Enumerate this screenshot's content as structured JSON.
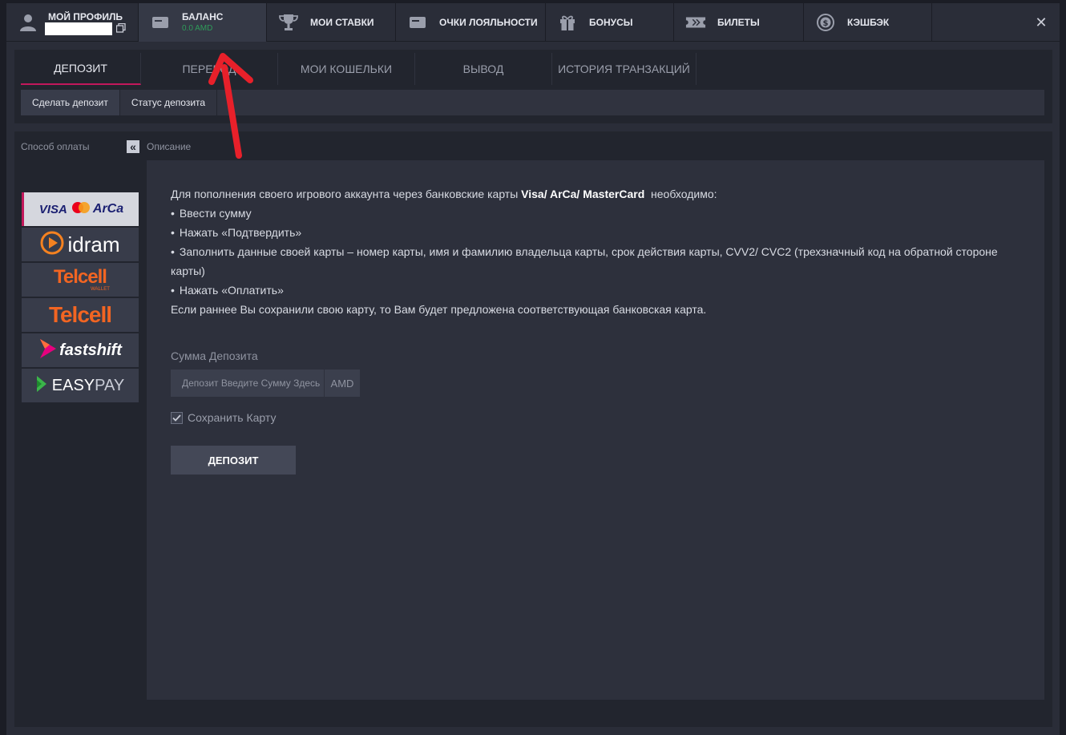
{
  "nav": {
    "profile_label": "Мой профиль",
    "balance_label": "Баланс",
    "balance_amount": "0.0 AMD",
    "bets_label": "Мои ставки",
    "loyalty_label": "Очки лояльности",
    "bonuses_label": "Бонусы",
    "tickets_label": "Билеты",
    "cashback_label": "Кэшбэк",
    "close_label": "✕"
  },
  "tabs": [
    "Депозит",
    "Перевод",
    "Мои кошельки",
    "Вывод",
    "История транзакций"
  ],
  "subtabs": [
    "Сделать депозит",
    "Статус депозита"
  ],
  "sidebar": {
    "title": "Способ оплаты",
    "collapse_label": "«",
    "methods": [
      {
        "name": "visa-arca",
        "logo_left": "VISA",
        "logo_right": "ArCa"
      },
      {
        "name": "idram",
        "logo": "idram"
      },
      {
        "name": "telcell-wallet",
        "logo": "Telcell",
        "sub": "WALLET"
      },
      {
        "name": "telcell",
        "logo": "Telcell"
      },
      {
        "name": "fastshift",
        "logo": "fastshift"
      },
      {
        "name": "easypay",
        "logo_left": "EASY",
        "logo_right": "PAY"
      }
    ]
  },
  "description": {
    "title": "Описание",
    "intro_pre": "Для пополнения своего игрового аккаунта через банковские карты ",
    "intro_bold": "Visa/ ArCa/ MasterCard",
    "intro_post": "  необходимо:",
    "steps": [
      "Ввести сумму",
      "Нажать «Подтвердить»",
      "Заполнить данные своей карты – номер карты, имя и фамилию владельца карты, срок действия карты, CVV2/ CVC2 (трехзначный код на обратной стороне карты)",
      "Нажать «Оплатить»"
    ],
    "footer": "Если раннее Вы сохранили свою карту, то Вам будет предложена соответствующая банковская карта."
  },
  "form": {
    "amount_label": "Сумма Депозита",
    "amount_placeholder": "Депозит Введите Сумму Здесь",
    "currency": "AMD",
    "save_card_label": "Сохранить Карту",
    "save_card_checked": true,
    "submit_label": "Депозит"
  },
  "colors": {
    "accent": "#c2185b",
    "annotation_arrow": "#e8202a",
    "balance_green": "#2f9b5a"
  }
}
